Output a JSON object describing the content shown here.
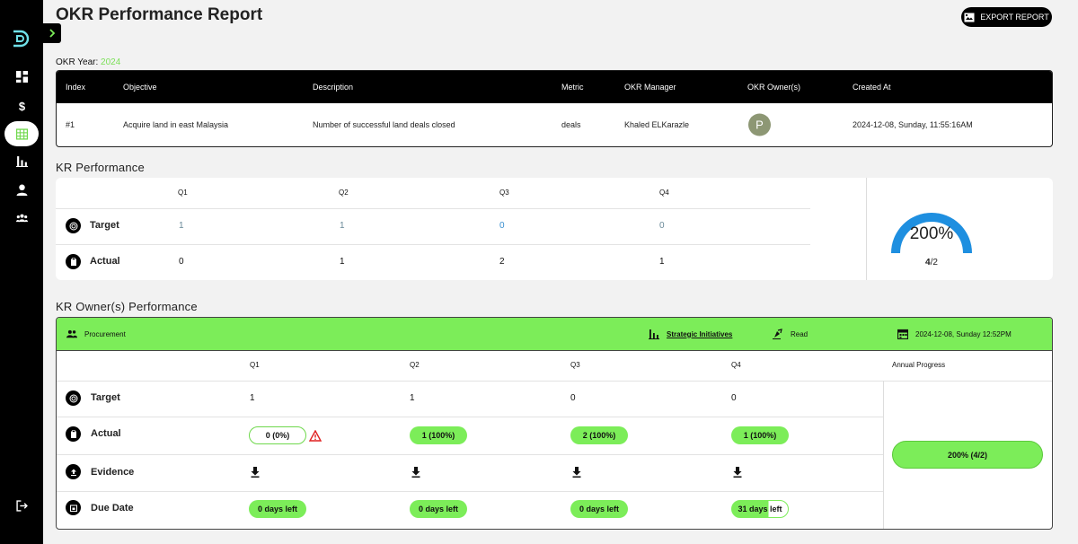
{
  "header": {
    "title": "OKR Performance Report",
    "export_label": "EXPORT REPORT"
  },
  "okr_year": {
    "label": "OKR Year:",
    "value": "2024"
  },
  "okr_table": {
    "columns": [
      "Index",
      "Objective",
      "Description",
      "Metric",
      "OKR Manager",
      "OKR Owner(s)",
      "Created At"
    ],
    "row": {
      "index": "#1",
      "objective": "Acquire land in east Malaysia",
      "description": "Number of successful land deals closed",
      "metric": "deals",
      "manager": "Khaled ELKarazle",
      "owner_initial": "P",
      "created_at": "2024-12-08, Sunday, 11:55:16AM"
    }
  },
  "kr_performance": {
    "title": "KR Performance",
    "quarters": [
      "Q1",
      "Q2",
      "Q3",
      "Q4"
    ],
    "target_label": "Target",
    "actual_label": "Actual",
    "target": [
      "1",
      "1",
      "0",
      "0"
    ],
    "actual": [
      "0",
      "1",
      "2",
      "1"
    ],
    "gauge": {
      "percent_text": "200%",
      "achieved": "4",
      "total": "2",
      "separator": "/",
      "fill_fraction": 1.0,
      "color": "#1e8fe0"
    }
  },
  "owner_performance": {
    "title": "KR Owner(s) Performance",
    "owner_name": "Procurement",
    "strategic_label": "Strategic Initiatives",
    "access_label": "Read",
    "datetime": "2024-12-08, Sunday 12:52PM",
    "quarters": [
      "Q1",
      "Q2",
      "Q3",
      "Q4"
    ],
    "annual_label": "Annual Progress",
    "target_label": "Target",
    "actual_label": "Actual",
    "evidence_label": "Evidence",
    "due_label": "Due Date",
    "target": [
      "1",
      "1",
      "0",
      "0"
    ],
    "actual": [
      "0 (0%)",
      "1 (100%)",
      "2 (100%)",
      "1 (100%)"
    ],
    "due": [
      "0 days left",
      "0 days left",
      "0 days left",
      "31 days left"
    ],
    "annual_progress": "200% (4/2)",
    "accent_color": "#7ced59",
    "warning_color": "#e02020"
  }
}
